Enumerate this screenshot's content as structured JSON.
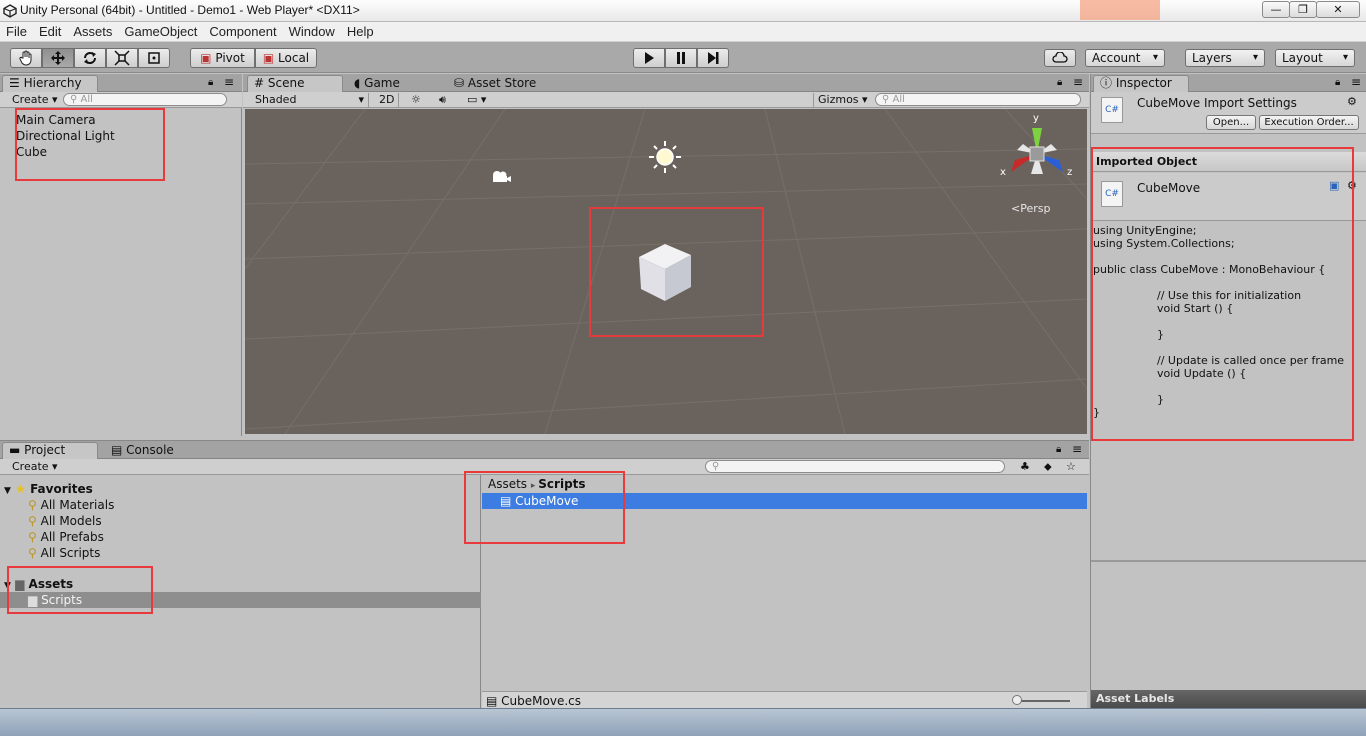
{
  "window": {
    "title": "Unity Personal (64bit) - Untitled - Demo1 - Web Player* <DX11>",
    "minimize": "—",
    "restore": "❐",
    "close": "✕"
  },
  "menu": [
    "File",
    "Edit",
    "Assets",
    "GameObject",
    "Component",
    "Window",
    "Help"
  ],
  "toolbar": {
    "pivot": "Pivot",
    "local": "Local",
    "account": "Account",
    "layers": "Layers",
    "layout": "Layout"
  },
  "hierarchy": {
    "tab": "Hierarchy",
    "create": "Create",
    "search_placeholder": "All",
    "items": [
      "Main Camera",
      "Directional Light",
      "Cube"
    ]
  },
  "scene": {
    "tabs": [
      "Scene",
      "Game",
      "Asset Store"
    ],
    "shading": "Shaded",
    "mode_2d": "2D",
    "gizmos": "Gizmos",
    "search_placeholder": "All",
    "persp": "Persp",
    "axis_y": "y",
    "axis_x": "x",
    "axis_z": "z"
  },
  "project": {
    "tabs": [
      "Project",
      "Console"
    ],
    "create": "Create",
    "favorites_label": "Favorites",
    "favorites": [
      "All Materials",
      "All Models",
      "All Prefabs",
      "All Scripts"
    ],
    "assets_label": "Assets",
    "folders": [
      "Scripts"
    ],
    "breadcrumb_root": "Assets",
    "breadcrumb_current": "Scripts",
    "files": [
      "CubeMove"
    ],
    "selected_path": "CubeMove.cs"
  },
  "inspector": {
    "tab": "Inspector",
    "title": "CubeMove Import Settings",
    "open_button": "Open...",
    "exec_order_button": "Execution Order...",
    "section": "Imported Object",
    "object_name": "CubeMove",
    "cs_icon": "C#",
    "code": [
      "using UnityEngine;",
      "using System.Collections;",
      "",
      "public class CubeMove : MonoBehaviour {",
      "",
      "\t// Use this for initialization",
      "\tvoid Start () {",
      "",
      "\t}",
      "",
      "\t// Update is called once per frame",
      "\tvoid Update () {",
      "",
      "\t}",
      "}"
    ],
    "asset_labels": "Asset Labels"
  },
  "colors": {
    "highlight": "#e8393c",
    "selection": "#3d7de2",
    "scene_bg": "#6a625d"
  }
}
